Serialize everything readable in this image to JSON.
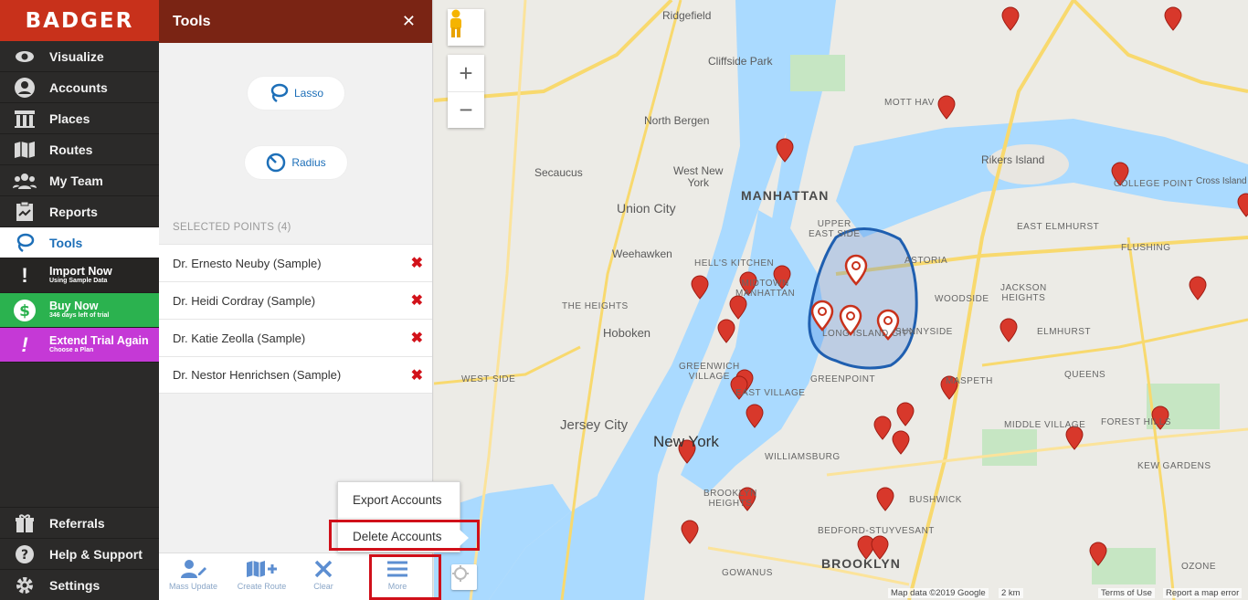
{
  "brand": {
    "name": "BADGER",
    "color": "#c8311b"
  },
  "nav": [
    {
      "label": "Visualize",
      "icon": "eye-icon"
    },
    {
      "label": "Accounts",
      "icon": "user-circle-icon"
    },
    {
      "label": "Places",
      "icon": "building-icon"
    },
    {
      "label": "Routes",
      "icon": "map-icon"
    },
    {
      "label": "My Team",
      "icon": "team-icon"
    },
    {
      "label": "Reports",
      "icon": "report-icon"
    },
    {
      "label": "Tools",
      "icon": "lasso-icon",
      "active": true
    }
  ],
  "promos": {
    "import": {
      "title": "Import Now",
      "sub": "Using Sample Data"
    },
    "buy": {
      "title": "Buy Now",
      "sub": "346 days left of trial"
    },
    "trial": {
      "title": "Extend Trial Again",
      "sub": "Choose a Plan"
    }
  },
  "bottom_nav": [
    {
      "label": "Referrals",
      "icon": "gift-icon"
    },
    {
      "label": "Help & Support",
      "icon": "help-icon"
    },
    {
      "label": "Settings",
      "icon": "gear-icon"
    }
  ],
  "panel": {
    "title": "Tools",
    "close": "✕",
    "lasso_label": "Lasso",
    "radius_label": "Radius",
    "selected_title": "SELECTED POINTS (4)",
    "selected": [
      "Dr. Ernesto Neuby (Sample)",
      "Dr. Heidi Cordray (Sample)",
      "Dr. Katie Zeolla (Sample)",
      "Dr. Nestor Henrichsen (Sample)"
    ],
    "remove_glyph": "✖"
  },
  "toolbar": {
    "mass_update": "Mass Update",
    "create_route": "Create Route",
    "clear": "Clear",
    "more": "More"
  },
  "popup": {
    "export": "Export Accounts",
    "delete": "Delete Accounts"
  },
  "map": {
    "labels": {
      "ridgefield": "Ridgefield",
      "cliffside": "Cliffside Park",
      "north_bergen": "North Bergen",
      "secaucus": "Secaucus",
      "west_new_york": "West New\nYork",
      "union_city": "Union City",
      "manhattan": "MANHATTAN",
      "weehawken": "Weehawken",
      "upper_east": "UPPER\nEAST SIDE",
      "hells_kitchen": "HELL'S KITCHEN",
      "midtown": "MIDTOWN\nMANHATTAN",
      "the_heights": "THE HEIGHTS",
      "hoboken": "Hoboken",
      "west_side": "WEST SIDE",
      "greenwich": "GREENWICH\nVILLAGE",
      "east_village": "EAST VILLAGE",
      "jersey_city": "Jersey City",
      "new_york": "New York",
      "williamsburg": "WILLIAMSBURG",
      "brooklyn_heights": "BROOKLYN\nHEIGHTS",
      "bushwick": "BUSHWICK",
      "bedford": "BEDFORD-STUYVESANT",
      "brooklyn": "BROOKLYN",
      "gowanus": "GOWANUS",
      "astoria": "ASTORIA",
      "woodside": "WOODSIDE",
      "jackson_heights": "JACKSON\nHEIGHTS",
      "elmhurst": "ELMHURST",
      "greenpoint": "GREENPOINT",
      "flushing": "FLUSHING",
      "east_elmhurst": "EAST ELMHURST",
      "rikers": "Rikers Island",
      "college_point": "COLLEGE POINT",
      "cross_island": "Cross Island",
      "middle_village": "MIDDLE VILLAGE",
      "forest_hills": "FOREST HILLS",
      "kew_gardens": "KEW GARDENS",
      "mott_haven": "MOTT HAV",
      "queens": "QUEENS",
      "lic": "LONG ISLAND CITY",
      "sunnyside": "SUNNYSIDE",
      "maspeth": "MASPETH",
      "ozone": "OZONE"
    },
    "footer": {
      "data": "Map data ©2019 Google",
      "scale": "2 km",
      "terms": "Terms of Use",
      "report": "Report a map error"
    }
  },
  "colors": {
    "accent": "#1d6fb8",
    "pin": "#d8382b",
    "highlight": "#d0101a"
  }
}
